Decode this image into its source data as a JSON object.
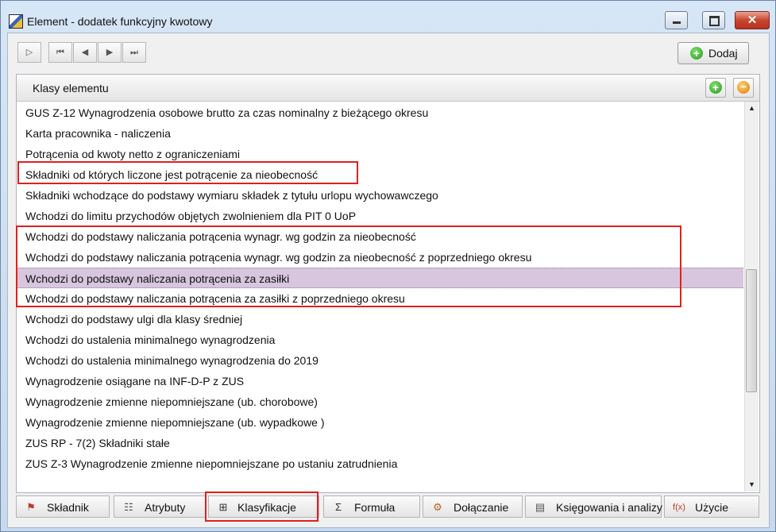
{
  "window": {
    "title": "Element - dodatek funkcyjny kwotowy",
    "close_glyph": "✕"
  },
  "toolbar": {
    "nav": [
      {
        "name": "new-record-button",
        "glyph": "▷"
      },
      {
        "name": "first-record-button",
        "glyph": "⏮"
      },
      {
        "name": "prev-record-button",
        "glyph": "◀"
      },
      {
        "name": "next-record-button",
        "glyph": "▶"
      },
      {
        "name": "last-record-button",
        "glyph": "⏭"
      }
    ],
    "add_label": "Dodaj"
  },
  "panel": {
    "title": "Klasy elementu",
    "items": [
      "GUS Z-12 Wynagrodzenia osobowe brutto za czas nominalny z bieżącego okresu",
      "Karta pracownika - naliczenia",
      "Potrącenia od kwoty netto z ograniczeniami",
      "Składniki od których liczone jest potrącenie za nieobecność",
      "Składniki wchodzące do podstawy wymiaru składek z tytułu urlopu wychowawczego",
      "Wchodzi do limitu przychodów objętych zwolnieniem dla PIT 0 UoP",
      "Wchodzi do podstawy naliczania potrącenia wynagr. wg godzin za nieobecność",
      "Wchodzi do podstawy naliczania potrącenia wynagr. wg godzin za nieobecność z poprzedniego okresu",
      "Wchodzi do podstawy naliczania potrącenia za zasiłki",
      "Wchodzi do podstawy naliczania potrącenia za zasiłki z poprzedniego okresu",
      "Wchodzi do podstawy ulgi dla klasy średniej",
      "Wchodzi do ustalenia minimalnego wynagrodzenia",
      "Wchodzi do ustalenia minimalnego wynagrodzenia do 2019",
      "Wynagrodzenie osiągane na INF-D-P z ZUS",
      "Wynagrodzenie zmienne niepomniejszane (ub. chorobowe)",
      "Wynagrodzenie zmienne niepomniejszane (ub. wypadkowe )",
      "ZUS RP - 7(2) Składniki stałe",
      "ZUS Z-3 Wynagrodzenie zmienne niepomniejszane po ustaniu zatrudnienia"
    ],
    "selected_index": 8,
    "scroll": {
      "up": "▲",
      "down": "▼"
    }
  },
  "tabs": [
    {
      "label": "Składnik",
      "icon": "skladnik-icon",
      "glyph": "⚑",
      "color": "#c0392b"
    },
    {
      "label": "Atrybuty",
      "icon": "attributes-icon",
      "glyph": "☷",
      "color": "#555555"
    },
    {
      "label": "Klasyfikacje",
      "icon": "classification-icon",
      "glyph": "⊞",
      "color": "#333333"
    },
    {
      "label": "Formuła",
      "icon": "formula-icon",
      "glyph": "Σ",
      "color": "#333333"
    },
    {
      "label": "Dołączanie",
      "icon": "attach-icon",
      "glyph": "⚙",
      "color": "#b5651d"
    },
    {
      "label": "Księgowania i analizy",
      "icon": "accounting-icon",
      "glyph": "▤",
      "color": "#555555"
    },
    {
      "label": "Użycie",
      "icon": "usage-icon",
      "glyph": "f(x)",
      "color": "#c0392b"
    }
  ],
  "colors": {
    "selection": "#d8c5de",
    "annotation": "#e02020",
    "add_green": "#2a9a1e",
    "remove_orange": "#e07a00"
  }
}
